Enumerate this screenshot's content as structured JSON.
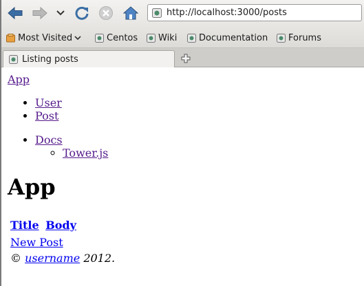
{
  "browser": {
    "url": "http://localhost:3000/posts",
    "bookmarks": [
      {
        "label": "Most Visited",
        "icon": "most-visited-icon"
      },
      {
        "label": "Centos",
        "icon": "page-icon"
      },
      {
        "label": "Wiki",
        "icon": "page-icon"
      },
      {
        "label": "Documentation",
        "icon": "page-icon"
      },
      {
        "label": "Forums",
        "icon": "page-icon"
      }
    ],
    "tab": {
      "title": "Listing posts"
    }
  },
  "page": {
    "brand": "App",
    "nav": [
      "User",
      "Post"
    ],
    "docs": {
      "label": "Docs",
      "children": [
        "Tower.js"
      ]
    },
    "heading": "App",
    "table_headers": [
      "Title",
      "Body"
    ],
    "new_post": "New Post",
    "footer": {
      "copyright": "©",
      "author": "username",
      "year": "2012."
    }
  },
  "colors": {
    "visited_link": "#551a8b",
    "link": "#0000ee",
    "toolbar_icon": "#3b6ea5"
  }
}
